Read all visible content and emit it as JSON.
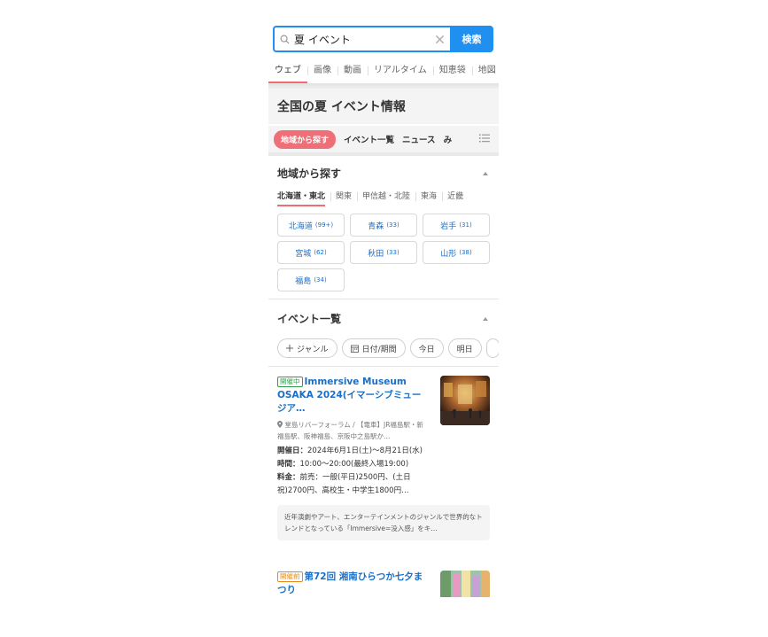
{
  "search": {
    "query": "夏 イベント",
    "button": "検索"
  },
  "tabs": [
    "ウェブ",
    "画像",
    "動画",
    "リアルタイム",
    "知恵袋",
    "地図"
  ],
  "page_title": "全国の夏 イベント情報",
  "chip_tabs": {
    "active": "地域から探す",
    "items": [
      "イベント一覧",
      "ニュース",
      "み"
    ]
  },
  "region": {
    "heading": "地域から探す",
    "tabs": [
      "北海道・東北",
      "関東",
      "甲信越・北陸",
      "東海",
      "近畿"
    ],
    "prefectures": [
      {
        "name": "北海道",
        "count": "(99+)"
      },
      {
        "name": "青森",
        "count": "(33)"
      },
      {
        "name": "岩手",
        "count": "(31)"
      },
      {
        "name": "宮城",
        "count": "(62)"
      },
      {
        "name": "秋田",
        "count": "(33)"
      },
      {
        "name": "山形",
        "count": "(38)"
      },
      {
        "name": "福島",
        "count": "(34)"
      }
    ]
  },
  "events_section": {
    "heading": "イベント一覧",
    "filters": {
      "genre": "ジャンル",
      "date": "日付/期間",
      "today": "今日",
      "tomorrow": "明日"
    }
  },
  "events": [
    {
      "badge": "開催中",
      "title": "Immersive Museum OSAKA 2024(イマーシブミュージア…",
      "location": "堂島リバーフォーラム / 【電車】JR福島駅・新福島駅、阪神福島、京阪中之島駅か…",
      "date_label": "開催日：",
      "date_value": "2024年6月1日(土)〜8月21日(水)",
      "time_label": "時間：",
      "time_value": "10:00〜20:00(最終入場19:00)",
      "fee_label": "料金：",
      "fee_value": "前売：一般(平日)2500円、(土日祝)2700円、高校生・中学生1800円…",
      "desc": "近年演劇やアート、エンターテインメントのジャンルで世界的なトレンドとなっている「Immersive=没入感」をキ…"
    },
    {
      "badge": "開催前",
      "title": "第72回 湘南ひらつか七夕まつり"
    }
  ],
  "colors": {
    "accent": "#1f8ff0",
    "pink": "#ef6f78",
    "link": "#1a6fc9"
  }
}
